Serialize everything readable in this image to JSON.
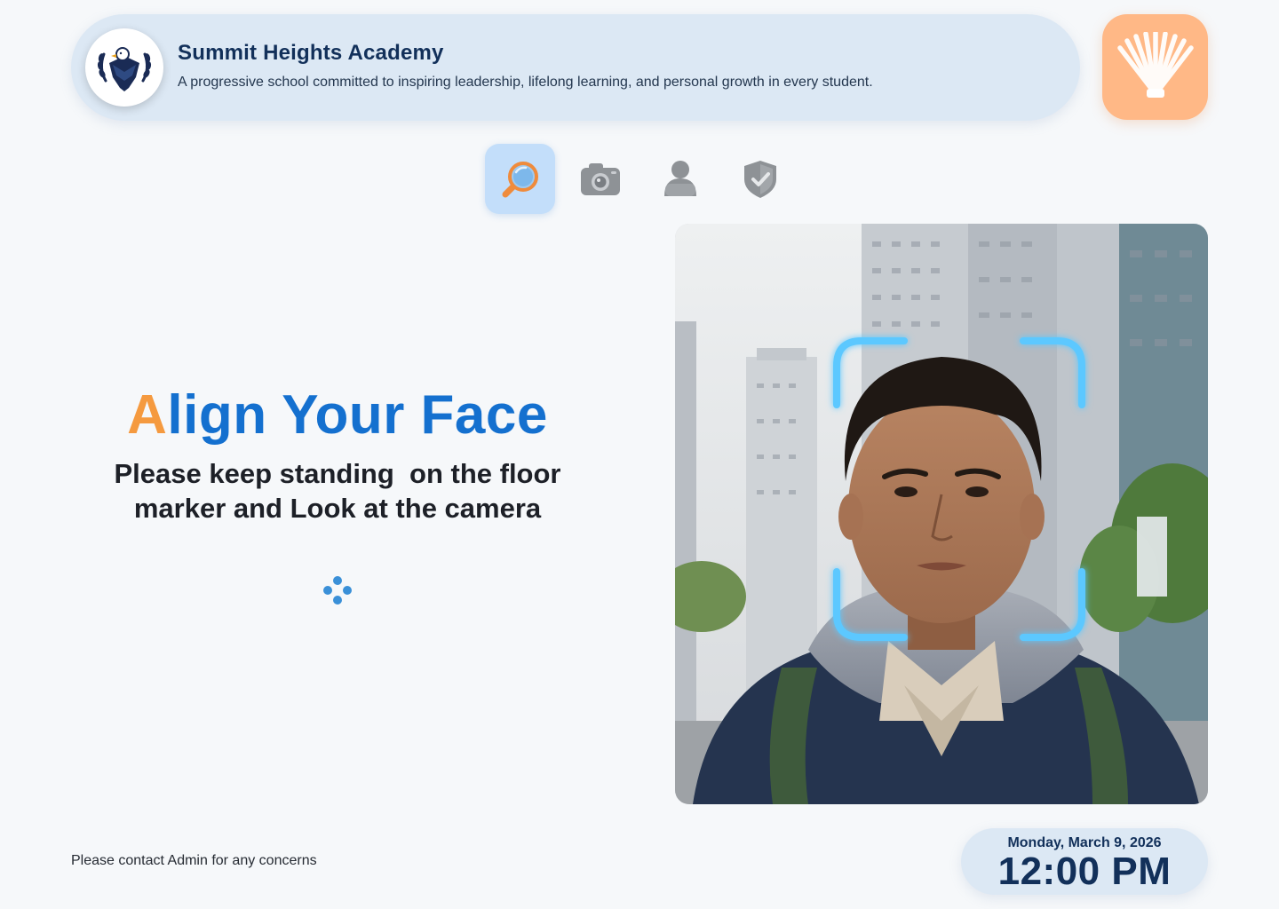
{
  "header": {
    "school_name": "Summit Heights Academy",
    "tagline": "A progressive school committed to inspiring leadership, lifelong learning, and personal growth in every student.",
    "logo_icon": "eagle-crest-icon",
    "app_icon": "shell-icon"
  },
  "steps": [
    {
      "icon": "search-icon",
      "state": "active"
    },
    {
      "icon": "camera-icon",
      "state": "inactive"
    },
    {
      "icon": "user-icon",
      "state": "inactive"
    },
    {
      "icon": "shield-check-icon",
      "state": "inactive"
    }
  ],
  "instruction": {
    "headline_first_letter": "A",
    "headline_rest": "lign Your Face",
    "line1": "Please keep standing  on the floor",
    "line2": "marker and Look at the camera"
  },
  "footer": {
    "contact": "Please contact Admin for any concerns",
    "date": "Monday, March 9, 2026",
    "time": "12:00 PM"
  },
  "colors": {
    "accent_blue": "#1470cf",
    "accent_orange": "#f59a3f",
    "header_bg": "#dce8f4",
    "scan_frame": "#5cc8ff",
    "app_icon_bg": "#ffb886"
  }
}
